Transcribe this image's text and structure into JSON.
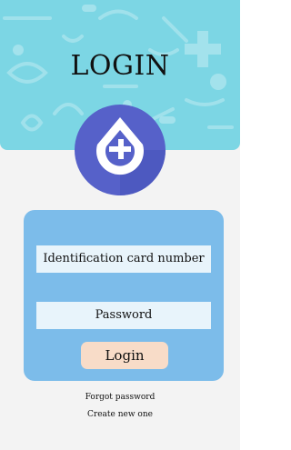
{
  "header": {
    "title": "LOGIN",
    "background_color": "#7cd6e4",
    "logo_icon": "drop-cross-icon"
  },
  "form": {
    "id_field": {
      "placeholder": "Identification card number",
      "value": ""
    },
    "password_field": {
      "placeholder": "Password",
      "value": ""
    },
    "login_label": "Login",
    "panel_color": "#7cbcea",
    "button_color": "#f8dcc8"
  },
  "links": {
    "forgot_password": "Forgot password",
    "create_account": "Create new one"
  }
}
